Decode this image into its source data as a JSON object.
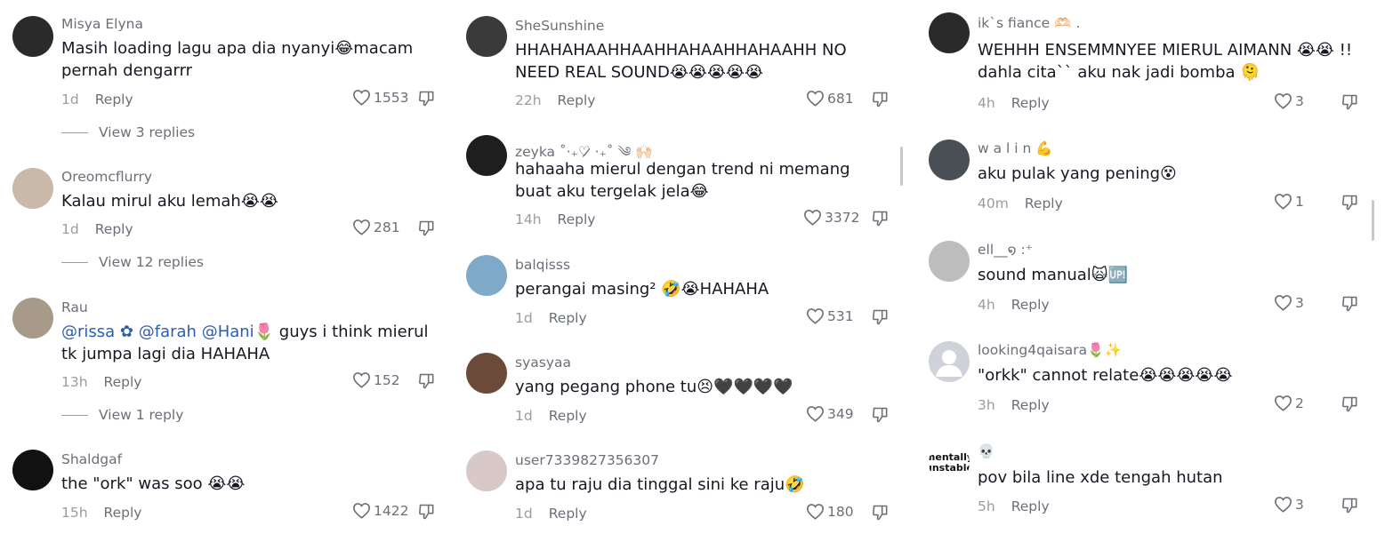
{
  "columns": [
    {
      "comments": [
        {
          "username": "Misya Elyna",
          "text": "Masih loading lagu apa dia nyanyi😂macam pernah dengarrr",
          "time": "1d",
          "reply_label": "Reply",
          "likes": "1553",
          "view_replies": "View 3 replies",
          "avatar_color": "#2a2a2a"
        },
        {
          "username": "Oreomcflurry",
          "text": "Kalau mirul aku lemah😭😭",
          "time": "1d",
          "reply_label": "Reply",
          "likes": "281",
          "view_replies": "View 12 replies",
          "avatar_color": "#c9b9a8"
        },
        {
          "username": "Rau",
          "text_parts": [
            "@rissa ✿",
            "@farah",
            "@Hani",
            "🌷 guys i think mierul tk jumpa lagi dia HAHAHA"
          ],
          "time": "13h",
          "reply_label": "Reply",
          "likes": "152",
          "view_replies": "View 1 reply",
          "avatar_color": "#a89a88"
        },
        {
          "username": "Shaldgaf",
          "text": "the \"ork\" was soo 😭😭",
          "time": "15h",
          "reply_label": "Reply",
          "likes": "1422",
          "avatar_color": "#111111"
        }
      ]
    },
    {
      "comments": [
        {
          "username": "SheSunshine",
          "text": "HHAHAHAAHHAAHHAHAAHHAHAAHH NO NEED REAL SOUND😭😭😭😭😭",
          "time": "22h",
          "reply_label": "Reply",
          "likes": "681",
          "avatar_color": "#3a3a3a"
        },
        {
          "username": "zeyka ˚‧₊♡̷̷ ‧₊˚ ༄ 🙌🏻",
          "text": "hahaaha mierul dengan trend ni memang buat aku tergelak jela😂",
          "time": "14h",
          "reply_label": "Reply",
          "likes": "3372",
          "avatar_color": "#1e1e1e"
        },
        {
          "username": "balqisss",
          "text": "perangai masing² 🤣😭HAHAHA",
          "time": "1d",
          "reply_label": "Reply",
          "likes": "531",
          "avatar_color": "#7fa9c9"
        },
        {
          "username": "syasyaa",
          "text": "yang pegang phone tu😣🖤🖤🖤🖤",
          "time": "1d",
          "reply_label": "Reply",
          "likes": "349",
          "avatar_color": "#6b4a3a"
        },
        {
          "username": "user7339827356307",
          "text": "apa tu raju dia tinggal sini ke raju🤣",
          "time": "1d",
          "reply_label": "Reply",
          "likes": "180",
          "avatar_color": "#d9c8c8"
        }
      ]
    },
    {
      "comments": [
        {
          "username": "ik`s fiance 🫶🏻 .",
          "text": "WEHHH ENSEMMNYEE MIERUL AIMANN 😭😭 !! dahla cita`` aku nak jadi bomba 🫠",
          "time": "4h",
          "reply_label": "Reply",
          "likes": "3",
          "avatar_color": "#2a2a2a"
        },
        {
          "username": "w a l i n 💪",
          "text": "aku pulak yang pening😵",
          "time": "40m",
          "reply_label": "Reply",
          "likes": "1",
          "avatar_color": "#4a4f55"
        },
        {
          "username": "ell__໑ :⁺",
          "text": "sound manual🙀🆙",
          "time": "4h",
          "reply_label": "Reply",
          "likes": "3",
          "avatar_color": "#bdbdbd"
        },
        {
          "username": "looking4qaisara🌷✨",
          "text": "\"orkk\" cannot relate😭😭😭😭😭",
          "time": "3h",
          "reply_label": "Reply",
          "likes": "2",
          "avatar_color": "#cfd3d9"
        },
        {
          "username": "💀",
          "text": "pov bila line xde tengah hutan",
          "time": "5h",
          "reply_label": "Reply",
          "likes": "3",
          "avatar_color": "#ffffff",
          "avatar_text": "mentally unstable"
        }
      ]
    }
  ]
}
